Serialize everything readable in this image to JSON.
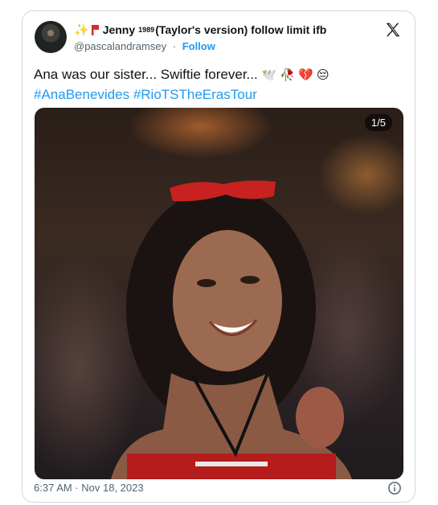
{
  "tweet": {
    "display_name": "Jenny",
    "display_name_sup": "1989",
    "display_name_rest": "(Taylor's version) follow limit ifb",
    "handle": "@pascalandramsey",
    "separator": "·",
    "follow_label": "Follow",
    "text": "Ana was our sister... Swiftie forever...",
    "emojis": "🕊️ 🥀 💔 😔",
    "hashtags": "#AnaBenevides #RioTSTheErasTour",
    "photo_counter": "1/5",
    "timestamp": "6:37 AM · Nov 18, 2023"
  },
  "icons": {
    "sparkle": "sparkles-icon",
    "flag": "red-flag-icon",
    "logo": "x-logo-icon",
    "info": "info-icon"
  },
  "colors": {
    "accent": "#1d9bf0",
    "text": "#0f1419",
    "muted": "#536471",
    "border": "#cfd9de"
  }
}
